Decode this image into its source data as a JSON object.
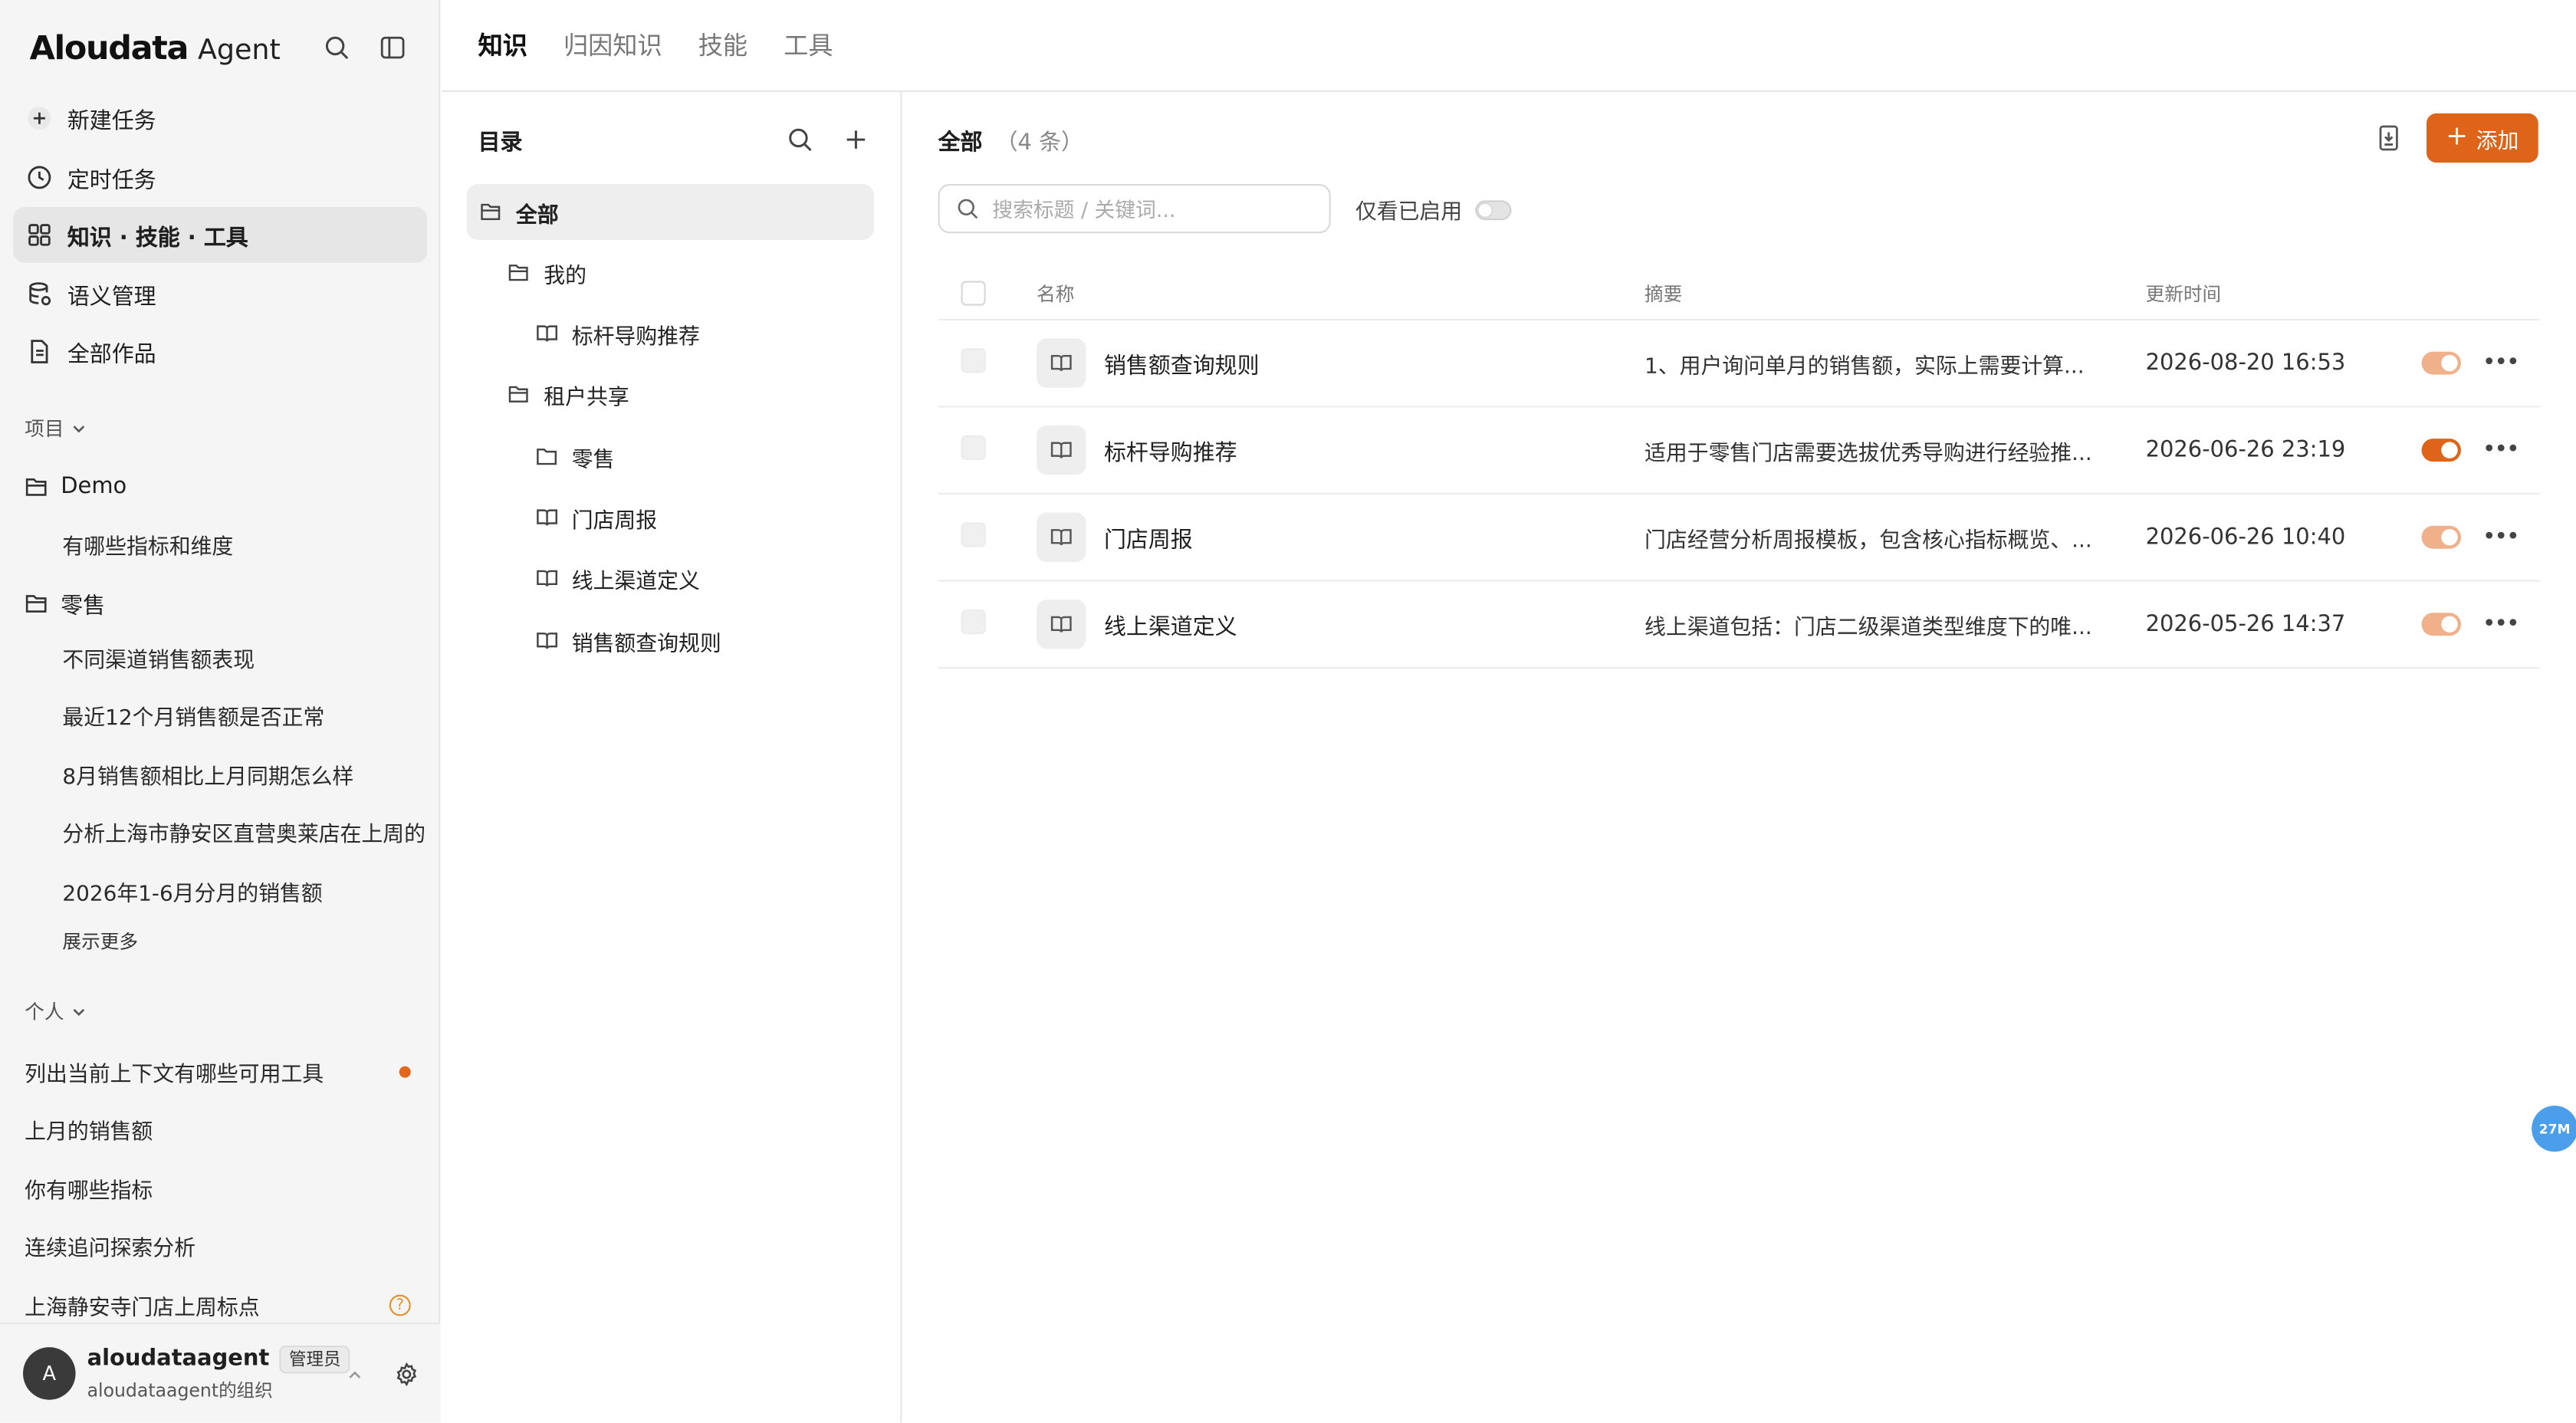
{
  "app": {
    "logo": "Aloudata",
    "logo_sub": "Agent"
  },
  "sidebar": {
    "nav": [
      {
        "label": "新建任务",
        "icon": "plus-circle-icon"
      },
      {
        "label": "定时任务",
        "icon": "clock-icon"
      },
      {
        "label": "知识 · 技能 · 工具",
        "icon": "grid-icon"
      },
      {
        "label": "语义管理",
        "icon": "database-icon"
      },
      {
        "label": "全部作品",
        "icon": "document-icon"
      }
    ],
    "projects_label": "项目",
    "projects": [
      {
        "name": "Demo",
        "items": [
          "有哪些指标和维度"
        ]
      },
      {
        "name": "零售",
        "items": [
          "不同渠道销售额表现",
          "最近12个月销售额是否正常",
          "8月销售额相比上月同期怎么样",
          "分析上海市静安区直营奥莱店在上周的",
          "2026年1-6月分月的销售额"
        ]
      }
    ],
    "show_more": "展示更多",
    "personal_label": "个人",
    "personal": [
      {
        "label": "列出当前上下文有哪些可用工具",
        "status": "dot"
      },
      {
        "label": "上月的销售额",
        "status": ""
      },
      {
        "label": "你有哪些指标",
        "status": ""
      },
      {
        "label": "连续追问探索分析",
        "status": ""
      },
      {
        "label": "上海静安寺门店上周标点",
        "status": "question"
      }
    ],
    "user": {
      "avatar": "A",
      "name": "aloudataagent",
      "role": "管理员",
      "org": "aloudataagent的组织"
    }
  },
  "tabs": [
    "知识",
    "归因知识",
    "技能",
    "工具"
  ],
  "directory": {
    "title": "目录",
    "items": [
      {
        "label": "全部",
        "icon": "folder-open-icon"
      },
      {
        "label": "我的",
        "icon": "folder-open-icon"
      },
      {
        "label": "标杆导购推荐",
        "icon": "book-icon"
      },
      {
        "label": "租户共享",
        "icon": "folder-open-icon"
      },
      {
        "label": "零售",
        "icon": "folder-icon"
      },
      {
        "label": "门店周报",
        "icon": "book-icon"
      },
      {
        "label": "线上渠道定义",
        "icon": "book-icon"
      },
      {
        "label": "销售额查询规则",
        "icon": "book-icon"
      }
    ]
  },
  "main": {
    "title": "全部",
    "count": "（4 条）",
    "add_label": "添加",
    "search_placeholder": "搜索标题 / 关键词...",
    "filter_label": "仅看已启用",
    "columns": [
      "名称",
      "摘要",
      "更新时间"
    ],
    "rows": [
      {
        "name": "销售额查询规则",
        "summary": "1、用户询问单月的销售额，实际上需要计算...",
        "time": "2026-08-20 16:53",
        "enabled": false
      },
      {
        "name": "标杆导购推荐",
        "summary": "适用于零售门店需要选拔优秀导购进行经验推...",
        "time": "2026-06-26 23:19",
        "enabled": true
      },
      {
        "name": "门店周报",
        "summary": "门店经营分析周报模板，包含核心指标概览、...",
        "time": "2026-06-26 10:40",
        "enabled": false
      },
      {
        "name": "线上渠道定义",
        "summary": "线上渠道包括：门店二级渠道类型维度下的唯...",
        "time": "2026-05-26 14:37",
        "enabled": false
      }
    ]
  },
  "float_badge": "27M",
  "colors": {
    "accent": "#de6419",
    "sidebar_bg": "#f5f5f5",
    "badge": "#4a9eea"
  }
}
